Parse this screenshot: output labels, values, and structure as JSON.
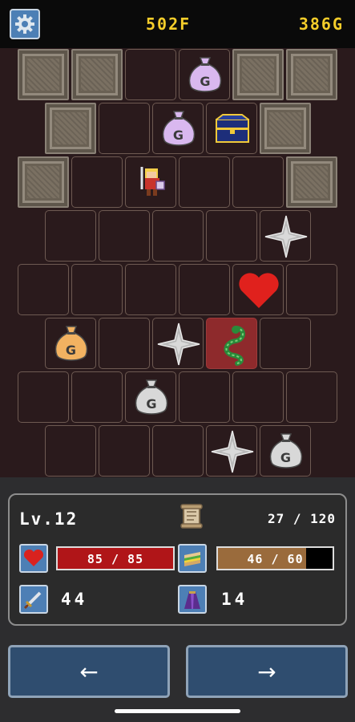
{
  "header": {
    "floor": "502F",
    "gold": "386G",
    "settings_icon": "gear-icon"
  },
  "board": {
    "bag_letter": "G",
    "tiles": [
      {
        "kind": "wall",
        "c": 0,
        "r": 0
      },
      {
        "kind": "wall",
        "c": 1,
        "r": 0
      },
      {
        "kind": "empty",
        "c": 2,
        "r": 0
      },
      {
        "kind": "bag",
        "c": 3,
        "r": 0,
        "color": "#d9b8ef"
      },
      {
        "kind": "wall",
        "c": 4,
        "r": 0
      },
      {
        "kind": "wall",
        "c": 5,
        "r": 0
      },
      {
        "kind": "wall",
        "c": 0.5,
        "r": 1
      },
      {
        "kind": "empty",
        "c": 1.5,
        "r": 1
      },
      {
        "kind": "bag",
        "c": 2.5,
        "r": 1,
        "color": "#d9b8ef"
      },
      {
        "kind": "chest",
        "c": 3.5,
        "r": 1
      },
      {
        "kind": "wall",
        "c": 4.5,
        "r": 1
      },
      {
        "kind": "wall",
        "c": 0,
        "r": 2
      },
      {
        "kind": "empty",
        "c": 1,
        "r": 2
      },
      {
        "kind": "hero",
        "c": 2,
        "r": 2
      },
      {
        "kind": "empty",
        "c": 3,
        "r": 2
      },
      {
        "kind": "empty",
        "c": 4,
        "r": 2
      },
      {
        "kind": "wall",
        "c": 5,
        "r": 2
      },
      {
        "kind": "empty",
        "c": 0.5,
        "r": 3
      },
      {
        "kind": "empty",
        "c": 1.5,
        "r": 3
      },
      {
        "kind": "empty",
        "c": 2.5,
        "r": 3
      },
      {
        "kind": "empty",
        "c": 3.5,
        "r": 3
      },
      {
        "kind": "spike",
        "c": 4.5,
        "r": 3
      },
      {
        "kind": "empty",
        "c": 0,
        "r": 4
      },
      {
        "kind": "empty",
        "c": 1,
        "r": 4
      },
      {
        "kind": "empty",
        "c": 2,
        "r": 4
      },
      {
        "kind": "empty",
        "c": 3,
        "r": 4
      },
      {
        "kind": "heart",
        "c": 4,
        "r": 4
      },
      {
        "kind": "empty",
        "c": 5,
        "r": 4
      },
      {
        "kind": "bag",
        "c": 0.5,
        "r": 5,
        "color": "#f2b261"
      },
      {
        "kind": "empty",
        "c": 1.5,
        "r": 5
      },
      {
        "kind": "spike",
        "c": 2.5,
        "r": 5
      },
      {
        "kind": "snake",
        "c": 3.5,
        "r": 5
      },
      {
        "kind": "empty",
        "c": 4.5,
        "r": 5
      },
      {
        "kind": "empty",
        "c": 0,
        "r": 6
      },
      {
        "kind": "empty",
        "c": 1,
        "r": 6
      },
      {
        "kind": "bag",
        "c": 2,
        "r": 6,
        "color": "#d8d8d8"
      },
      {
        "kind": "empty",
        "c": 3,
        "r": 6
      },
      {
        "kind": "empty",
        "c": 4,
        "r": 6
      },
      {
        "kind": "empty",
        "c": 5,
        "r": 6
      },
      {
        "kind": "empty",
        "c": 0.5,
        "r": 7
      },
      {
        "kind": "empty",
        "c": 1.5,
        "r": 7
      },
      {
        "kind": "empty",
        "c": 2.5,
        "r": 7
      },
      {
        "kind": "spike",
        "c": 3.5,
        "r": 7
      },
      {
        "kind": "bag",
        "c": 4.5,
        "r": 7,
        "color": "#d8d8d8"
      }
    ]
  },
  "status": {
    "level": "Lv.12",
    "xp": "27 / 120",
    "hp_text": "85 / 85",
    "hp_fraction": 1.0,
    "hp_color": "#b01518",
    "food_text": "46 / 60",
    "food_fraction": 0.7667,
    "food_color": "#9a6b3c",
    "attack": "44",
    "defense": "14",
    "icons": {
      "hp": "heart-icon",
      "food": "sandwich-icon",
      "attack": "sword-icon",
      "defense": "robe-icon",
      "quest": "scroll-icon"
    }
  },
  "controls": {
    "left_label": "←",
    "right_label": "→"
  }
}
